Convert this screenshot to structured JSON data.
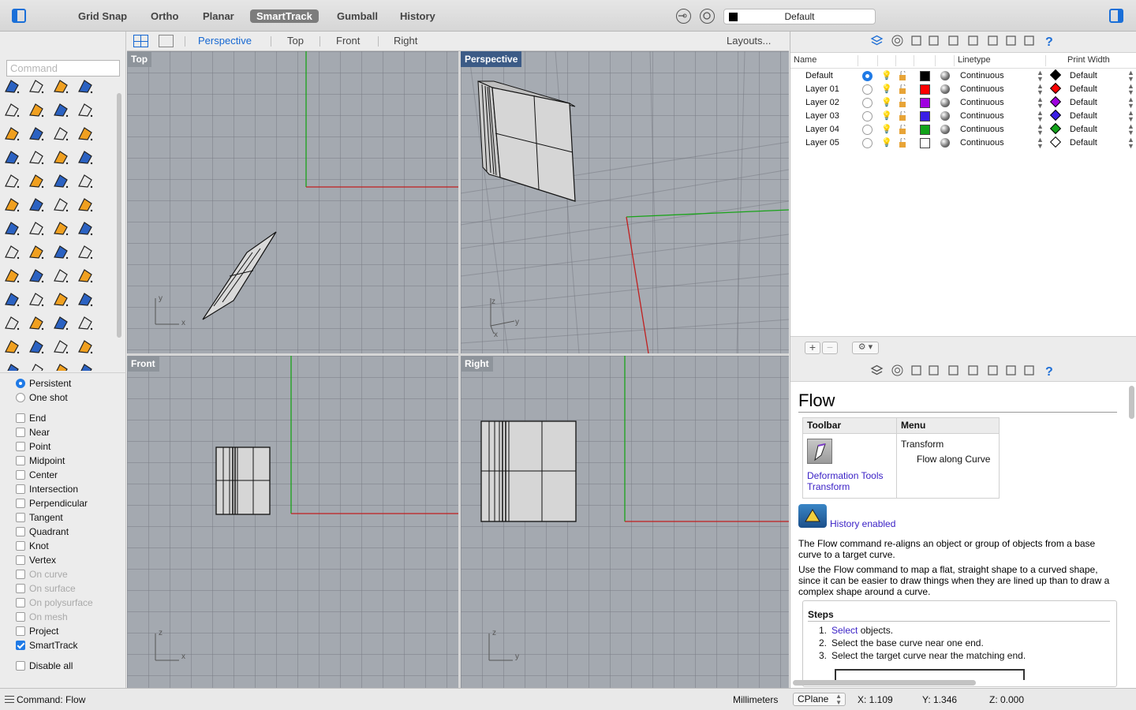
{
  "toolbar": {
    "modes": [
      "Grid Snap",
      "Ortho",
      "Planar",
      "SmartTrack",
      "Gumball",
      "History"
    ],
    "active_mode": "SmartTrack",
    "current_layer": "Default"
  },
  "command": {
    "placeholder": "Command"
  },
  "viewport_tabs": {
    "items": [
      "Perspective",
      "Top",
      "Front",
      "Right"
    ],
    "active": "Perspective",
    "layouts_label": "Layouts..."
  },
  "viewports": {
    "top": "Top",
    "perspective": "Perspective",
    "front": "Front",
    "right": "Right"
  },
  "axis_labels": {
    "x": "x",
    "y": "y",
    "z": "z"
  },
  "osnap": {
    "mode_options": [
      {
        "label": "Persistent",
        "selected": true
      },
      {
        "label": "One shot",
        "selected": false
      }
    ],
    "snaps": [
      {
        "label": "End",
        "checked": false,
        "enabled": true
      },
      {
        "label": "Near",
        "checked": false,
        "enabled": true
      },
      {
        "label": "Point",
        "checked": false,
        "enabled": true
      },
      {
        "label": "Midpoint",
        "checked": false,
        "enabled": true
      },
      {
        "label": "Center",
        "checked": false,
        "enabled": true
      },
      {
        "label": "Intersection",
        "checked": false,
        "enabled": true
      },
      {
        "label": "Perpendicular",
        "checked": false,
        "enabled": true
      },
      {
        "label": "Tangent",
        "checked": false,
        "enabled": true
      },
      {
        "label": "Quadrant",
        "checked": false,
        "enabled": true
      },
      {
        "label": "Knot",
        "checked": false,
        "enabled": true
      },
      {
        "label": "Vertex",
        "checked": false,
        "enabled": true
      },
      {
        "label": "On curve",
        "checked": false,
        "enabled": false
      },
      {
        "label": "On surface",
        "checked": false,
        "enabled": false
      },
      {
        "label": "On polysurface",
        "checked": false,
        "enabled": false
      },
      {
        "label": "On mesh",
        "checked": false,
        "enabled": false
      },
      {
        "label": "Project",
        "checked": false,
        "enabled": true
      },
      {
        "label": "SmartTrack",
        "checked": true,
        "enabled": true
      }
    ],
    "disable_all": "Disable all"
  },
  "layers_panel": {
    "headers": {
      "name": "Name",
      "linetype": "Linetype",
      "print_width": "Print Width"
    },
    "rows": [
      {
        "name": "Default",
        "current": true,
        "color": "#000000",
        "linetype": "Continuous",
        "print_color": "#000000",
        "print_width": "Default"
      },
      {
        "name": "Layer 01",
        "current": false,
        "color": "#ff0000",
        "linetype": "Continuous",
        "print_color": "#ff0000",
        "print_width": "Default"
      },
      {
        "name": "Layer 02",
        "current": false,
        "color": "#a000e0",
        "linetype": "Continuous",
        "print_color": "#a000e0",
        "print_width": "Default"
      },
      {
        "name": "Layer 03",
        "current": false,
        "color": "#3a1fe6",
        "linetype": "Continuous",
        "print_color": "#3a1fe6",
        "print_width": "Default"
      },
      {
        "name": "Layer 04",
        "current": false,
        "color": "#12a31a",
        "linetype": "Continuous",
        "print_color": "#12a31a",
        "print_width": "Default"
      },
      {
        "name": "Layer 05",
        "current": false,
        "color": "#ffffff",
        "linetype": "Continuous",
        "print_color": "#ffffff",
        "print_width": "Default"
      }
    ],
    "add_label": "+",
    "remove_label": "−"
  },
  "help": {
    "title": "Flow",
    "table": {
      "toolbar_header": "Toolbar",
      "menu_header": "Menu",
      "toolbar_links": [
        "Deformation Tools",
        "Transform"
      ],
      "menu_path": [
        "Transform",
        "Flow along Curve"
      ]
    },
    "history_label": "History enabled",
    "para1": "The Flow command re-aligns an object or group of objects from a base curve to a target curve.",
    "para2": "Use the Flow command to map a flat, straight shape to a curved shape, since it can be easier to draw things when they are lined up than to draw a complex shape around a curve.",
    "steps_title": "Steps",
    "steps": [
      {
        "num": "1.",
        "link": "Select",
        "text": " objects."
      },
      {
        "num": "2.",
        "link": "",
        "text": "Select the base curve near one end."
      },
      {
        "num": "3.",
        "link": "",
        "text": "Select the target curve near the matching end."
      }
    ]
  },
  "status": {
    "command": "Command: Flow",
    "units": "Millimeters",
    "cplane": "CPlane",
    "x": "X: 1.109",
    "y": "Y: 1.346",
    "z": "Z: 0.000"
  }
}
